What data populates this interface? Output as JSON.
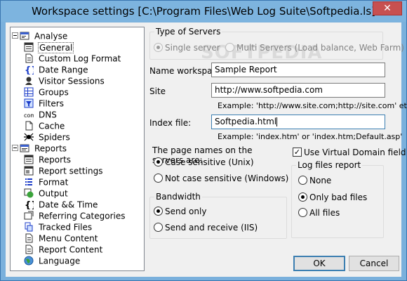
{
  "window": {
    "title": "Workspace settings [C:\\Program Files\\Web Log Suite\\Softpedia.ls]",
    "close_glyph": "✕"
  },
  "tree": {
    "groups": [
      {
        "label": "Analyse",
        "icon": "analyse-icon",
        "items": [
          {
            "label": "General",
            "icon": "general-icon",
            "selected": true
          },
          {
            "label": "Custom Log Format",
            "icon": "custom-log-format-icon"
          },
          {
            "label": "Date Range",
            "icon": "date-range-icon"
          },
          {
            "label": "Visitor Sessions",
            "icon": "visitor-sessions-icon"
          },
          {
            "label": "Groups",
            "icon": "groups-icon"
          },
          {
            "label": "Filters",
            "icon": "filters-icon"
          },
          {
            "label": "DNS",
            "icon": "dns-icon"
          },
          {
            "label": "Cache",
            "icon": "cache-icon"
          },
          {
            "label": "Spiders",
            "icon": "spiders-icon"
          }
        ]
      },
      {
        "label": "Reports",
        "icon": "reports-group-icon",
        "items": [
          {
            "label": "Reports",
            "icon": "reports-icon"
          },
          {
            "label": "Report settings",
            "icon": "report-settings-icon"
          },
          {
            "label": "Format",
            "icon": "format-icon"
          },
          {
            "label": "Output",
            "icon": "output-icon"
          },
          {
            "label": "Date && Time",
            "icon": "date-time-icon"
          },
          {
            "label": "Referring Categories",
            "icon": "referring-categories-icon"
          },
          {
            "label": "Tracked Files",
            "icon": "tracked-files-icon"
          },
          {
            "label": "Menu Content",
            "icon": "menu-content-icon"
          },
          {
            "label": "Report Content",
            "icon": "report-content-icon"
          },
          {
            "label": "Language",
            "icon": "language-icon"
          }
        ]
      }
    ]
  },
  "servers": {
    "title": "Type of Servers",
    "single": "Single server",
    "multi": "Multi Servers (Load balance, Web Farm)",
    "selected": "single"
  },
  "watermark": "SOFTPEDIA",
  "fields": {
    "workspace_label": "Name workspace:",
    "workspace_value": "Sample Report",
    "site_label": "Site",
    "site_value": "http://www.softpedia.com",
    "site_example": "Example: 'http://www.site.com;http://site.com' etc.",
    "index_label": "Index file:",
    "index_value": "Softpedia.html",
    "index_example": "Example: 'index.htm' or 'index.htm;Default.asp'"
  },
  "page_names": {
    "title": "The page names on the servers are:",
    "case_sensitive": "Case sensitive (Unix)",
    "not_case_sensitive": "Not case sensitive (Windows)",
    "selected": "case_sensitive"
  },
  "bandwidth": {
    "title": "Bandwidth",
    "send_only": "Send only",
    "send_receive": "Send and receive (IIS)",
    "selected": "send_only"
  },
  "virtual_domain": {
    "label": "Use Virtual Domain field",
    "checked": true
  },
  "log_files": {
    "title": "Log files report",
    "none": "None",
    "only_bad": "Only bad files",
    "all": "All files",
    "selected": "only_bad"
  },
  "buttons": {
    "ok": "OK",
    "cancel": "Cancel"
  },
  "colors": {
    "titlebar": "#7db4df",
    "close": "#c75050",
    "dialog_bg": "#f0f0f0"
  }
}
